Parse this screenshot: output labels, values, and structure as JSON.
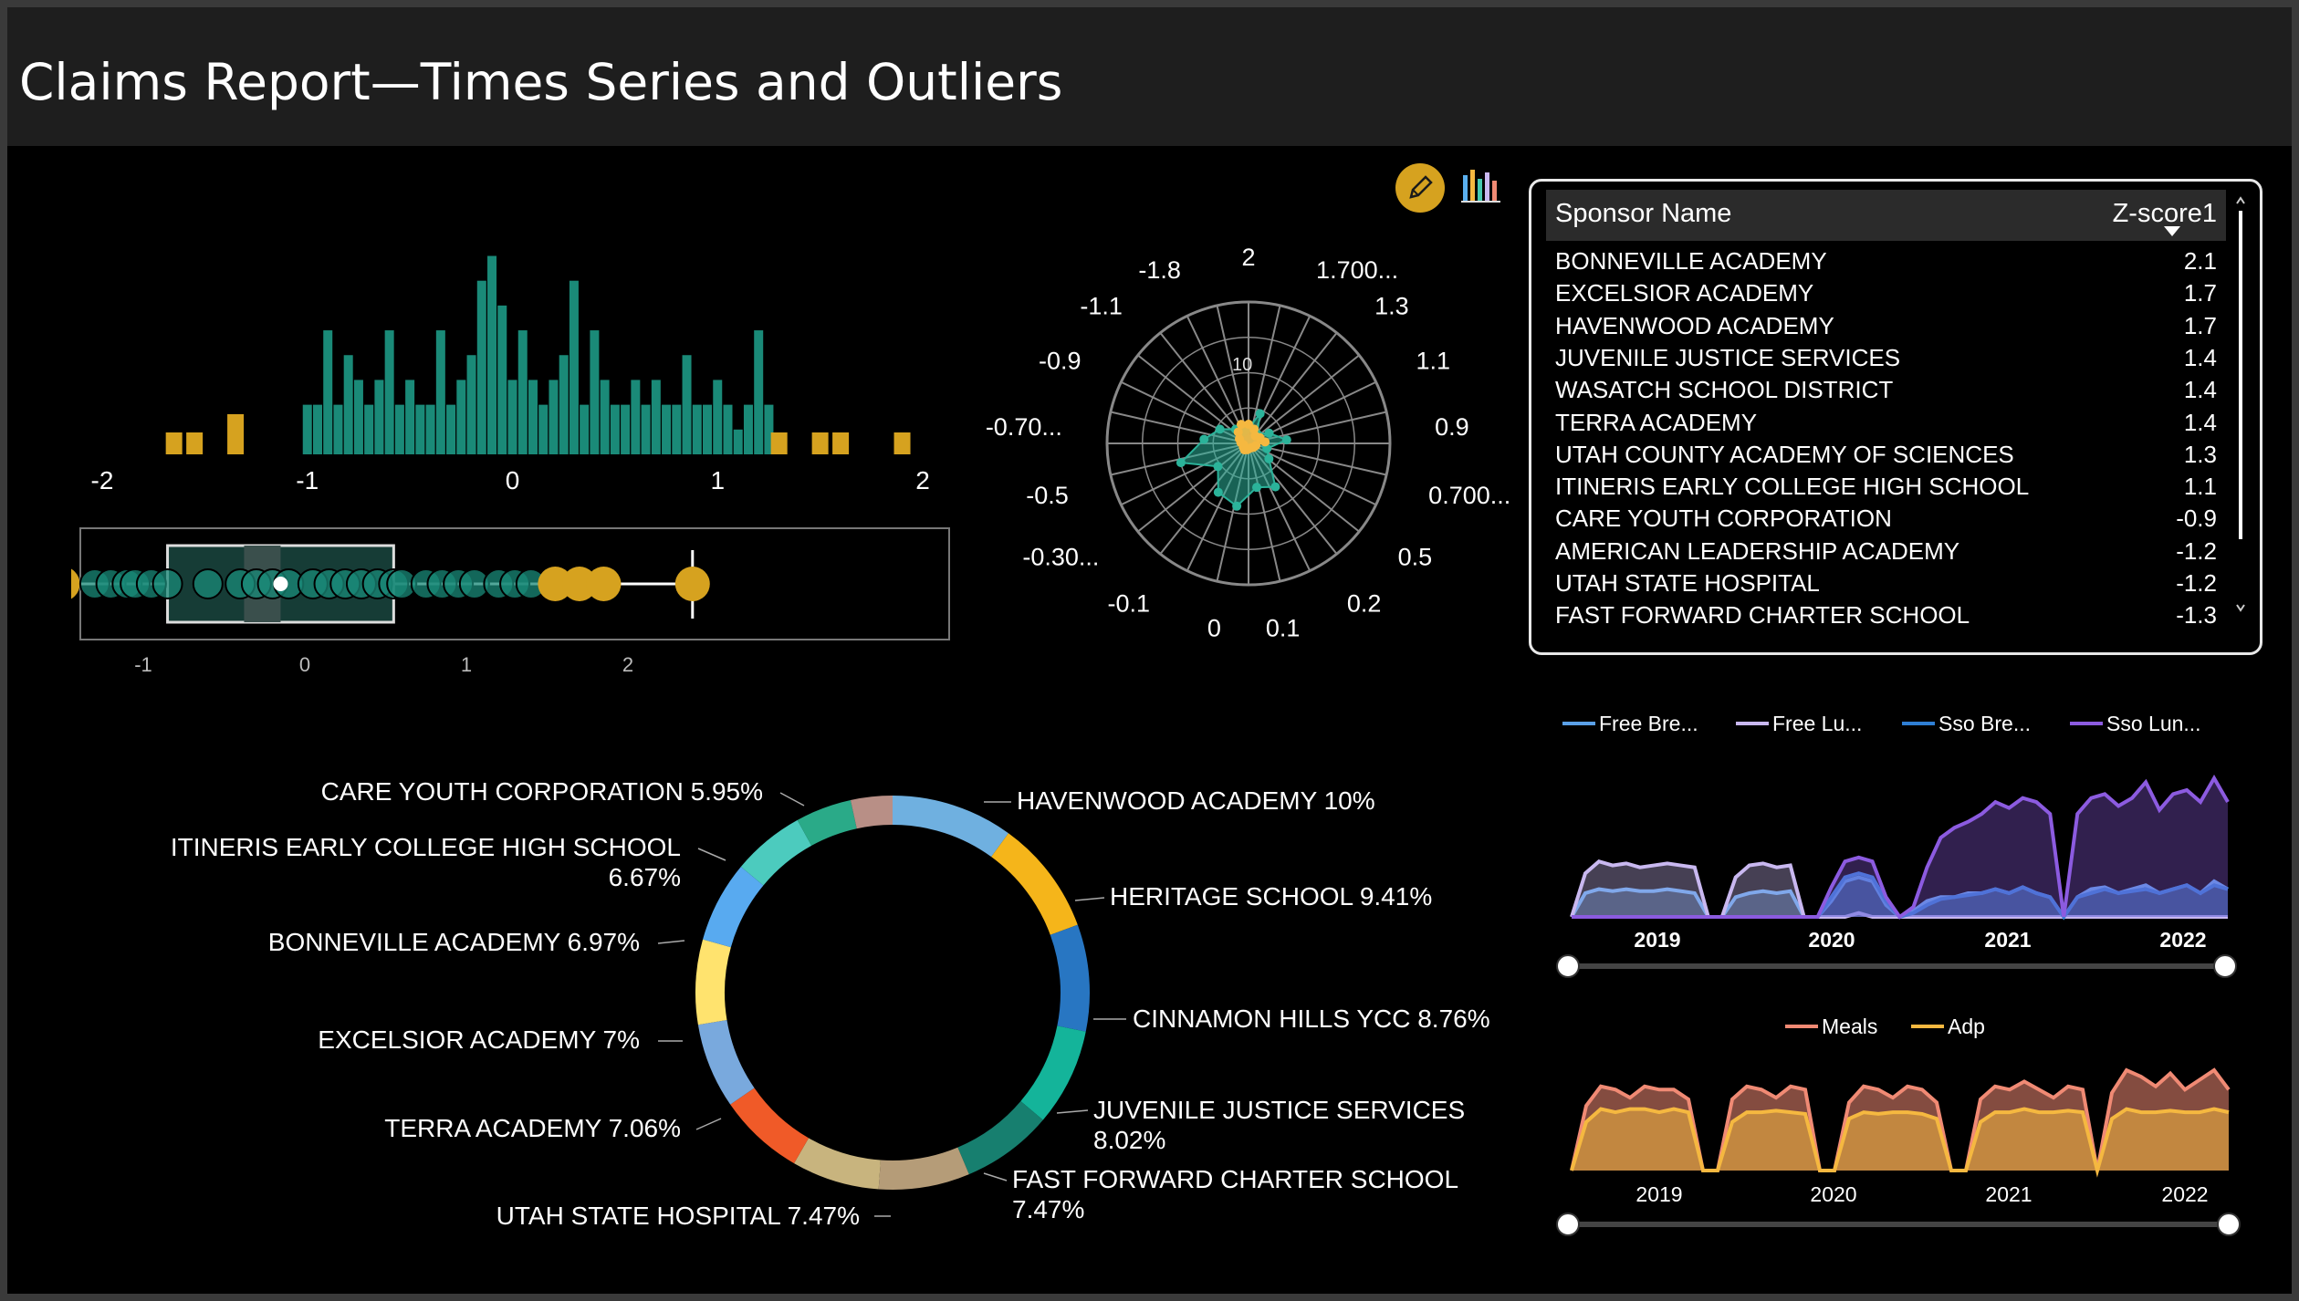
{
  "title": "Claims Report—Times Series and Outliers",
  "header_icons": [
    "edit-pencil-icon",
    "visual-chart-icon"
  ],
  "table": {
    "col_name": "Sponsor Name",
    "col_z": "Z-score1",
    "rows": [
      {
        "name": "BONNEVILLE ACADEMY",
        "z": "2.1"
      },
      {
        "name": "EXCELSIOR ACADEMY",
        "z": "1.7"
      },
      {
        "name": "HAVENWOOD ACADEMY",
        "z": "1.7"
      },
      {
        "name": "JUVENILE JUSTICE SERVICES",
        "z": "1.4"
      },
      {
        "name": "WASATCH SCHOOL DISTRICT",
        "z": "1.4"
      },
      {
        "name": "TERRA ACADEMY",
        "z": "1.4"
      },
      {
        "name": "UTAH COUNTY ACADEMY OF SCIENCES",
        "z": "1.3"
      },
      {
        "name": "ITINERIS EARLY COLLEGE HIGH SCHOOL",
        "z": "1.1"
      },
      {
        "name": "CARE YOUTH CORPORATION",
        "z": "-0.9"
      },
      {
        "name": "AMERICAN LEADERSHIP ACADEMY",
        "z": "-1.2"
      },
      {
        "name": "UTAH STATE HOSPITAL",
        "z": "-1.2"
      },
      {
        "name": "FAST FORWARD CHARTER SCHOOL",
        "z": "-1.3"
      }
    ]
  },
  "colors": {
    "teal": "#1a8a78",
    "gold": "#d6a21f",
    "free_bre": "#5aa0e8",
    "free_lu": "#c9b8f0",
    "sso_bre": "#2f7fd4",
    "sso_lun": "#8c5be0",
    "meals": "#f08a74",
    "adp": "#f5b840"
  },
  "chart_data": [
    {
      "type": "bar",
      "title": "",
      "description_axis": "z-score distribution",
      "xticks": [
        "-2",
        "-1",
        "0",
        "1",
        "2"
      ],
      "xlim": [
        -2,
        2
      ],
      "bins_x": [
        -1.65,
        -1.55,
        -1.35,
        -1.0,
        -0.95,
        -0.9,
        -0.85,
        -0.8,
        -0.75,
        -0.7,
        -0.65,
        -0.6,
        -0.55,
        -0.5,
        -0.45,
        -0.4,
        -0.35,
        -0.3,
        -0.25,
        -0.2,
        -0.15,
        -0.1,
        -0.05,
        0.0,
        0.05,
        0.1,
        0.15,
        0.2,
        0.25,
        0.3,
        0.35,
        0.4,
        0.45,
        0.5,
        0.55,
        0.6,
        0.65,
        0.7,
        0.75,
        0.8,
        0.85,
        0.9,
        0.95,
        1.0,
        1.05,
        1.1,
        1.15,
        1.2,
        1.25,
        1.3,
        1.5,
        1.6,
        1.9
      ],
      "values": [
        1,
        1,
        2,
        2,
        2,
        5,
        2,
        4,
        3,
        2,
        3,
        5,
        2,
        3,
        2,
        2,
        5,
        2,
        3,
        4,
        7,
        8,
        6,
        3,
        5,
        3,
        2,
        3,
        4,
        7,
        2,
        5,
        3,
        2,
        2,
        3,
        2,
        3,
        2,
        2,
        4,
        2,
        2,
        3,
        2,
        1,
        2,
        5,
        2,
        1,
        1,
        1,
        1
      ],
      "outlier_low": [
        -1.65,
        -1.55,
        -1.35
      ],
      "outlier_high": [
        1.3,
        1.5,
        1.6,
        1.9
      ]
    },
    {
      "type": "scatter",
      "title": "",
      "xticks": [
        "-2",
        "-1",
        "0",
        "1",
        "2"
      ],
      "box": {
        "whisker_low": -1.95,
        "q1": -0.85,
        "median": -0.15,
        "q3": 0.55,
        "whisker_high": 2.4,
        "mean": -0.15
      },
      "points_x": [
        -2.1,
        -1.9,
        -1.75,
        -1.5,
        -1.3,
        -1.2,
        -1.1,
        -1.05,
        -0.95,
        -0.85,
        -0.6,
        -0.4,
        -0.3,
        -0.2,
        -0.1,
        0.05,
        0.15,
        0.25,
        0.35,
        0.45,
        0.55,
        0.6,
        0.75,
        0.85,
        0.95,
        1.05,
        1.2,
        1.3,
        1.4,
        1.55,
        1.7,
        1.85,
        2.4
      ],
      "outliers_x": [
        -2.1,
        -1.9,
        -1.75,
        -1.5,
        1.55,
        1.7,
        1.85,
        2.4
      ]
    },
    {
      "type": "radar",
      "title": "",
      "axis_labels": [
        "2",
        "1.700...",
        "1.3",
        "1.1",
        "0.9",
        "0.700...",
        "0.5",
        "0.2",
        "0.1",
        "0",
        "-0.1",
        "-0.30...",
        "-0.5",
        "-0.70...",
        "-0.9",
        "-1.1",
        "-1.8"
      ],
      "ring_label": "10",
      "series_teal": [
        1.2,
        2.5,
        1.0,
        1.8,
        3.0,
        1.5,
        2.0,
        4.0,
        3.5,
        5.0,
        4.5,
        3.0,
        5.5,
        3.5,
        2.5,
        1.5,
        1.0
      ],
      "series_gold": [
        1.5,
        1.2,
        0.8,
        1.0,
        1.3,
        0.6,
        0.5,
        0.4,
        0.4,
        0.5,
        0.6,
        0.5,
        0.4,
        0.6,
        0.8,
        1.2,
        1.6
      ]
    },
    {
      "type": "pie",
      "title": "",
      "labels": [
        "HAVENWOOD ACADEMY",
        "HERITAGE SCHOOL",
        "CINNAMON HILLS YCC",
        "JUVENILE JUSTICE SERVICES",
        "FAST FORWARD CHARTER SCHOOL",
        "UTAH STATE HOSPITAL",
        "unlabeled slice",
        "TERRA ACADEMY",
        "EXCELSIOR ACADEMY",
        "BONNEVILLE ACADEMY",
        "ITINERIS EARLY COLLEGE HIGH SCHOOL",
        "CARE YOUTH CORPORATION",
        "unlabeled slice 2",
        "unlabeled slice 3"
      ],
      "values": [
        10,
        9.41,
        8.76,
        8.02,
        7.47,
        7.47,
        7.2,
        7.06,
        7,
        6.97,
        6.67,
        5.95,
        4.6,
        3.42
      ],
      "display": [
        "HAVENWOOD ACADEMY 10%",
        "HERITAGE SCHOOL 9.41%",
        "CINNAMON HILLS YCC 8.76%",
        "JUVENILE JUSTICE SERVICES",
        "8.02%",
        "FAST FORWARD CHARTER SCHOOL",
        "7.47%",
        "UTAH STATE HOSPITAL 7.47%",
        "TERRA ACADEMY 7.06%",
        "EXCELSIOR ACADEMY 7%",
        "BONNEVILLE ACADEMY 6.97%",
        "ITINERIS EARLY COLLEGE HIGH SCHOOL",
        "6.67%",
        "CARE YOUTH CORPORATION 5.95%"
      ],
      "colors": [
        "#6fb0e0",
        "#f5b51a",
        "#2876c2",
        "#14b49a",
        "#177f6f",
        "#b59c78",
        "#c8b47e",
        "#f05a28",
        "#79a9dd",
        "#ffe36e",
        "#58aaf0",
        "#4ccbbe",
        "#2aaa88",
        "#b88f86"
      ]
    },
    {
      "type": "area",
      "title": "",
      "legend": [
        "Free Bre...",
        "Free Lu...",
        "Sso Bre...",
        "Sso Lun..."
      ],
      "xticks": [
        "2019",
        "2020",
        "2021",
        "2022"
      ],
      "series": [
        {
          "name": "Free Bre...",
          "values": [
            0,
            12,
            14,
            13,
            14,
            13,
            13,
            14,
            13,
            12,
            0,
            0,
            10,
            12,
            13,
            12,
            13,
            0,
            0,
            8,
            18,
            20,
            18,
            6,
            0,
            3,
            8,
            10,
            10,
            12,
            12,
            14,
            12,
            15,
            12,
            10,
            0,
            10,
            14,
            15,
            12,
            14,
            16,
            12,
            14,
            16,
            12,
            18,
            14
          ]
        },
        {
          "name": "Free Lu...",
          "values": [
            0,
            22,
            28,
            26,
            27,
            25,
            26,
            27,
            26,
            25,
            0,
            0,
            20,
            26,
            27,
            25,
            26,
            0,
            0,
            0,
            0,
            2,
            0,
            0,
            0,
            0,
            0,
            0,
            0,
            0,
            0,
            0,
            0,
            0,
            0,
            0,
            0,
            0,
            0,
            0,
            0,
            0,
            0,
            0,
            0,
            0,
            0,
            0,
            0
          ]
        },
        {
          "name": "Sso Bre...",
          "values": [
            0,
            0,
            0,
            0,
            0,
            0,
            0,
            0,
            0,
            0,
            0,
            0,
            0,
            0,
            0,
            0,
            0,
            0,
            0,
            10,
            20,
            22,
            20,
            8,
            0,
            2,
            6,
            9,
            10,
            11,
            12,
            14,
            12,
            15,
            12,
            10,
            0,
            10,
            12,
            14,
            12,
            13,
            14,
            12,
            14,
            16,
            12,
            16,
            14
          ]
        },
        {
          "name": "Sso Lun...",
          "values": [
            0,
            0,
            0,
            0,
            0,
            0,
            0,
            0,
            0,
            0,
            0,
            0,
            0,
            0,
            0,
            0,
            0,
            0,
            0,
            15,
            28,
            30,
            28,
            10,
            0,
            5,
            25,
            40,
            45,
            48,
            52,
            58,
            55,
            60,
            58,
            52,
            0,
            52,
            60,
            62,
            56,
            60,
            68,
            54,
            62,
            64,
            58,
            70,
            58
          ]
        }
      ]
    },
    {
      "type": "area",
      "title": "",
      "legend": [
        "Meals",
        "Adp"
      ],
      "xticks": [
        "2019",
        "2020",
        "2021",
        "2022"
      ],
      "series": [
        {
          "name": "Meals",
          "values": [
            0,
            40,
            52,
            50,
            45,
            52,
            50,
            50,
            44,
            0,
            0,
            44,
            52,
            50,
            45,
            52,
            50,
            0,
            0,
            42,
            52,
            50,
            45,
            52,
            50,
            42,
            0,
            0,
            44,
            52,
            50,
            55,
            50,
            45,
            52,
            50,
            0,
            48,
            62,
            58,
            52,
            60,
            50,
            56,
            62,
            50
          ]
        },
        {
          "name": "Adp",
          "values": [
            0,
            30,
            38,
            36,
            38,
            38,
            36,
            38,
            36,
            0,
            0,
            30,
            36,
            36,
            37,
            36,
            35,
            0,
            0,
            32,
            36,
            35,
            36,
            36,
            35,
            32,
            0,
            0,
            30,
            36,
            36,
            38,
            36,
            36,
            37,
            36,
            0,
            32,
            38,
            36,
            36,
            37,
            36,
            36,
            38,
            36
          ]
        }
      ]
    }
  ]
}
